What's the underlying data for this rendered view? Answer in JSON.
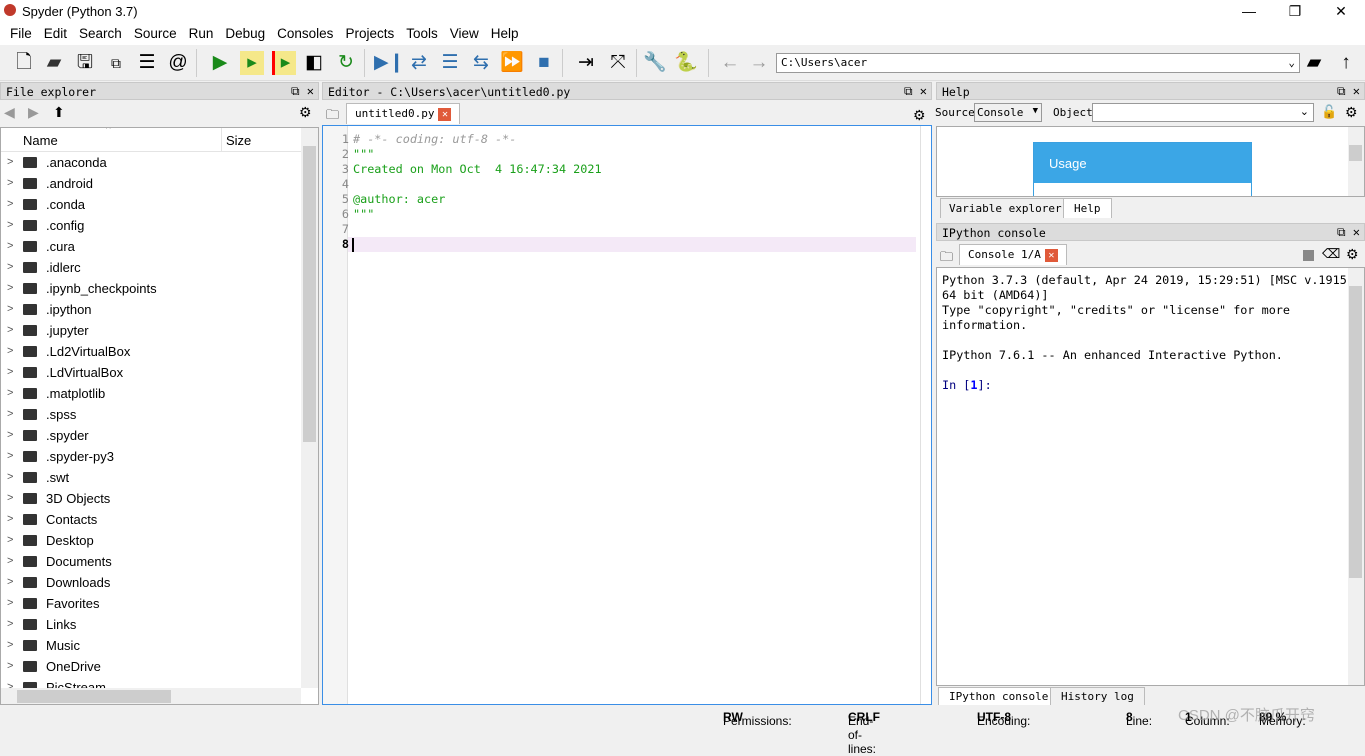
{
  "window": {
    "title": "Spyder (Python 3.7)",
    "minimize": "—",
    "maximize": "❐",
    "close": "✕"
  },
  "menu": [
    "File",
    "Edit",
    "Search",
    "Source",
    "Run",
    "Debug",
    "Consoles",
    "Projects",
    "Tools",
    "View",
    "Help"
  ],
  "toolbar": {
    "path": "C:\\Users\\acer",
    "icons": [
      "new-file",
      "open-file",
      "save",
      "save-all",
      "outline",
      "at-sign",
      "run",
      "run-cell",
      "run-cell-advance",
      "run-selection",
      "rerun",
      "debug",
      "step",
      "step-into",
      "step-return",
      "continue",
      "stop",
      "maximize-pane",
      "fullscreen",
      "preferences",
      "python-path",
      "back",
      "forward",
      "browse",
      "parent-dir"
    ]
  },
  "file_explorer": {
    "title": "File explorer",
    "col_name": "Name",
    "col_size": "Size",
    "items": [
      ".anaconda",
      ".android",
      ".conda",
      ".config",
      ".cura",
      ".idlerc",
      ".ipynb_checkpoints",
      ".ipython",
      ".jupyter",
      ".Ld2VirtualBox",
      ".LdVirtualBox",
      ".matplotlib",
      ".spss",
      ".spyder",
      ".spyder-py3",
      ".swt",
      "3D Objects",
      "Contacts",
      "Desktop",
      "Documents",
      "Downloads",
      "Favorites",
      "Links",
      "Music",
      "OneDrive",
      "PicStream"
    ]
  },
  "editor": {
    "title": "Editor - C:\\Users\\acer\\untitled0.py",
    "tab": "untitled0.py",
    "lines": [
      "# -*- coding: utf-8 -*-",
      "\"\"\"",
      "Created on Mon Oct  4 16:47:34 2021",
      "",
      "@author: acer",
      "\"\"\"",
      "",
      ""
    ],
    "current_line": 8
  },
  "help": {
    "title": "Help",
    "source_label": "Source",
    "source_value": "Console",
    "object_label": "Object",
    "object_value": "",
    "usage": "Usage",
    "tabs": [
      "Variable explorer",
      "Help"
    ],
    "active_tab": "Help"
  },
  "console": {
    "title": "IPython console",
    "tab": "Console 1/A",
    "output": [
      "Python 3.7.3 (default, Apr 24 2019, 15:29:51) [MSC v.1915",
      "64 bit (AMD64)]",
      "Type \"copyright\", \"credits\" or \"license\" for more",
      "information.",
      "",
      "IPython 7.6.1 -- An enhanced Interactive Python.",
      ""
    ],
    "prompt_pre": "In [",
    "prompt_num": "1",
    "prompt_post": "]:",
    "tabs": [
      "IPython console",
      "History log"
    ],
    "active_tab": "IPython console"
  },
  "status": {
    "permissions_label": "Permissions:",
    "permissions": "RW",
    "eol_label": "End-of-lines:",
    "eol": "CRLF",
    "encoding_label": "Encoding:",
    "encoding": "UTF-8",
    "line_label": "Line:",
    "line": "8",
    "column_label": "Column:",
    "column": "1",
    "memory_label": "Memory:",
    "memory": "89 %"
  },
  "watermark": "CSDN @不脑爪开窍"
}
